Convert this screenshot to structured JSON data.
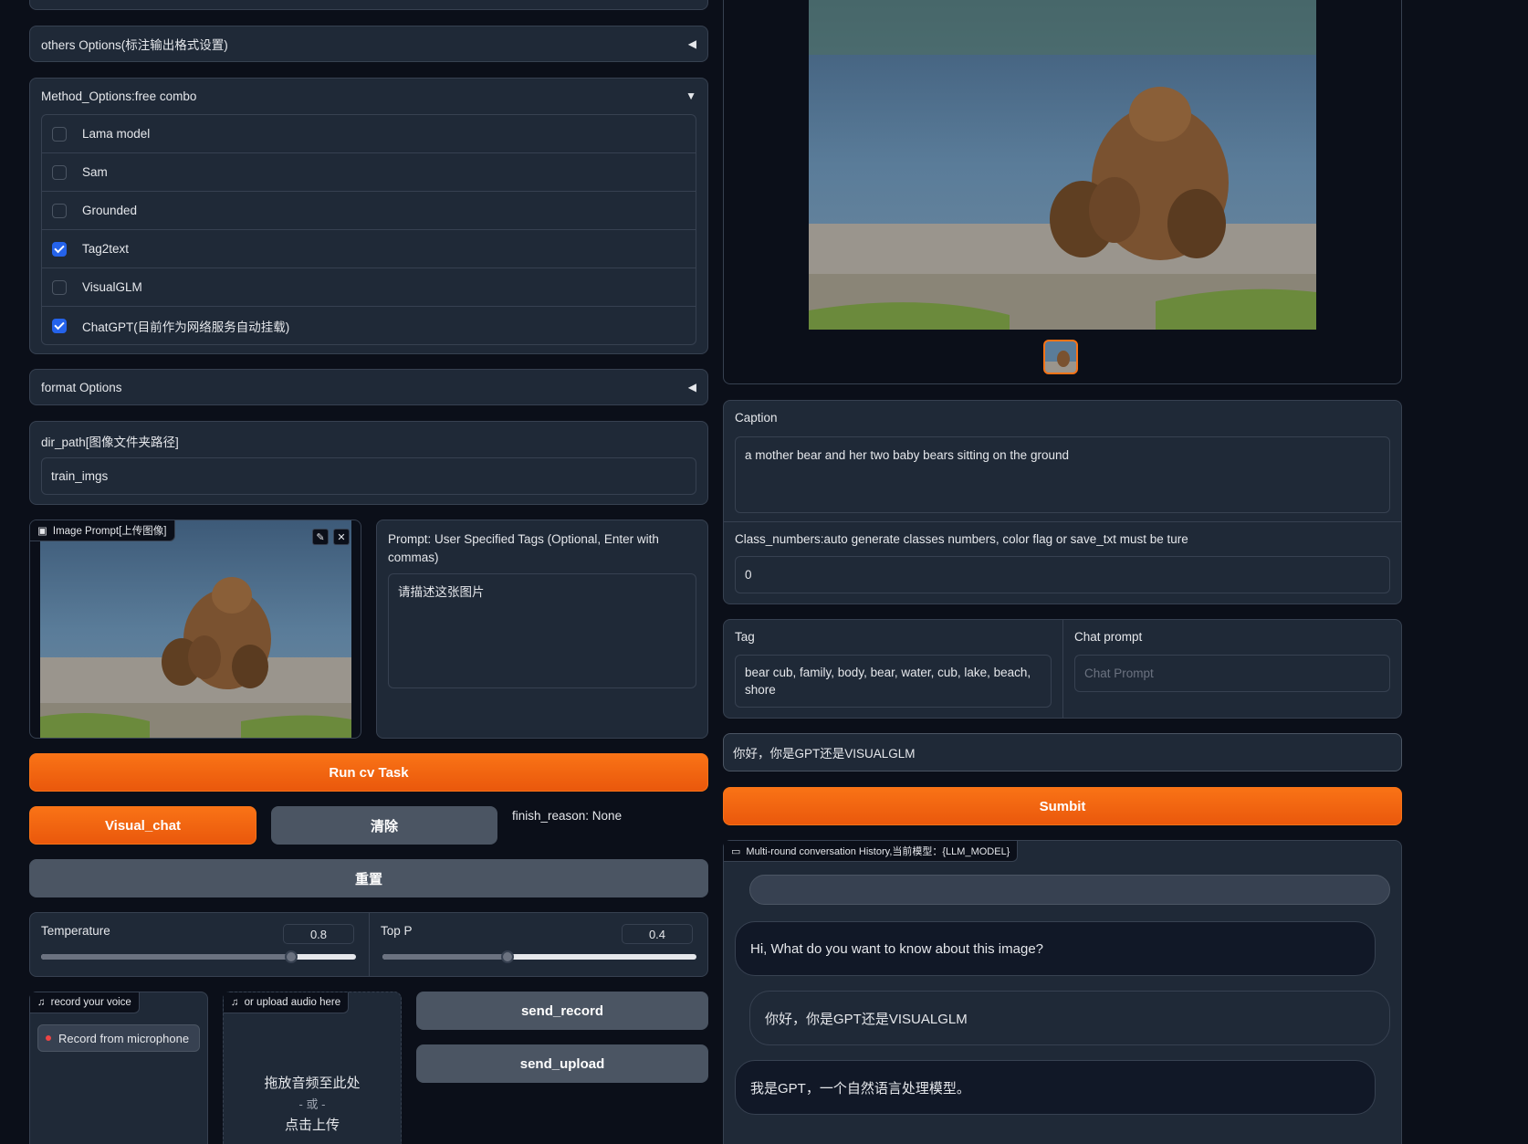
{
  "left": {
    "others_options": {
      "title": "others Options(标注输出格式设置)"
    },
    "method_options": {
      "title": "Method_Options:free combo",
      "items": [
        {
          "label": "Lama model",
          "checked": false
        },
        {
          "label": "Sam",
          "checked": false
        },
        {
          "label": "Grounded",
          "checked": false
        },
        {
          "label": "Tag2text",
          "checked": true
        },
        {
          "label": "VisualGLM",
          "checked": false
        },
        {
          "label": "ChatGPT(目前作为网络服务自动挂载)",
          "checked": true
        }
      ]
    },
    "format_options": {
      "title": "format Options"
    },
    "dir_path": {
      "label": "dir_path[图像文件夹路径]",
      "value": "train_imgs"
    },
    "image_prompt": {
      "label": "Image Prompt[上传图像]"
    },
    "prompt": {
      "label": "Prompt: User Specified Tags (Optional, Enter with commas)",
      "value": "请描述这张图片"
    },
    "run_button": "Run cv Task",
    "visual_chat_button": "Visual_chat",
    "clear_button": "清除",
    "finish_reason": "finish_reason: None",
    "reset_button": "重置",
    "temperature": {
      "label": "Temperature",
      "value": "0.8",
      "fraction": 0.8
    },
    "top_p": {
      "label": "Top P",
      "value": "0.4",
      "fraction": 0.4
    },
    "record": {
      "label": "record your voice",
      "button": "Record from microphone"
    },
    "upload": {
      "label": "or upload audio here",
      "drop": "拖放音频至此处",
      "or": "- 或 -",
      "click": "点击上传"
    },
    "send_record_button": "send_record",
    "send_upload_button": "send_upload"
  },
  "right": {
    "caption": {
      "label": "Caption",
      "value": "a mother bear and her two baby bears sitting on the ground"
    },
    "class_numbers": {
      "label": "Class_numbers:auto generate classes numbers, color flag or save_txt must be ture",
      "value": "0"
    },
    "tag": {
      "label": "Tag",
      "value": "bear cub, family, body, bear, water, cub, lake, beach, shore"
    },
    "chat_prompt": {
      "label": "Chat prompt",
      "placeholder": "Chat Prompt"
    },
    "message_input": "你好，你是GPT还是VISUALGLM",
    "submit_button": "Sumbit",
    "history": {
      "label": "Multi-round conversation History,当前模型：{LLM_MODEL}",
      "messages": [
        {
          "role": "bot",
          "text": "Hi, What do you want to know about this image?"
        },
        {
          "role": "user",
          "text": "你好，你是GPT还是VISUALGLM"
        },
        {
          "role": "bot",
          "text": "我是GPT，一个自然语言处理模型。"
        }
      ]
    }
  },
  "colors": {
    "primary": "#f97316",
    "secondary": "#4b5563",
    "background": "#0b0f19",
    "panel": "#1f2937",
    "checkbox": "#2563eb"
  }
}
